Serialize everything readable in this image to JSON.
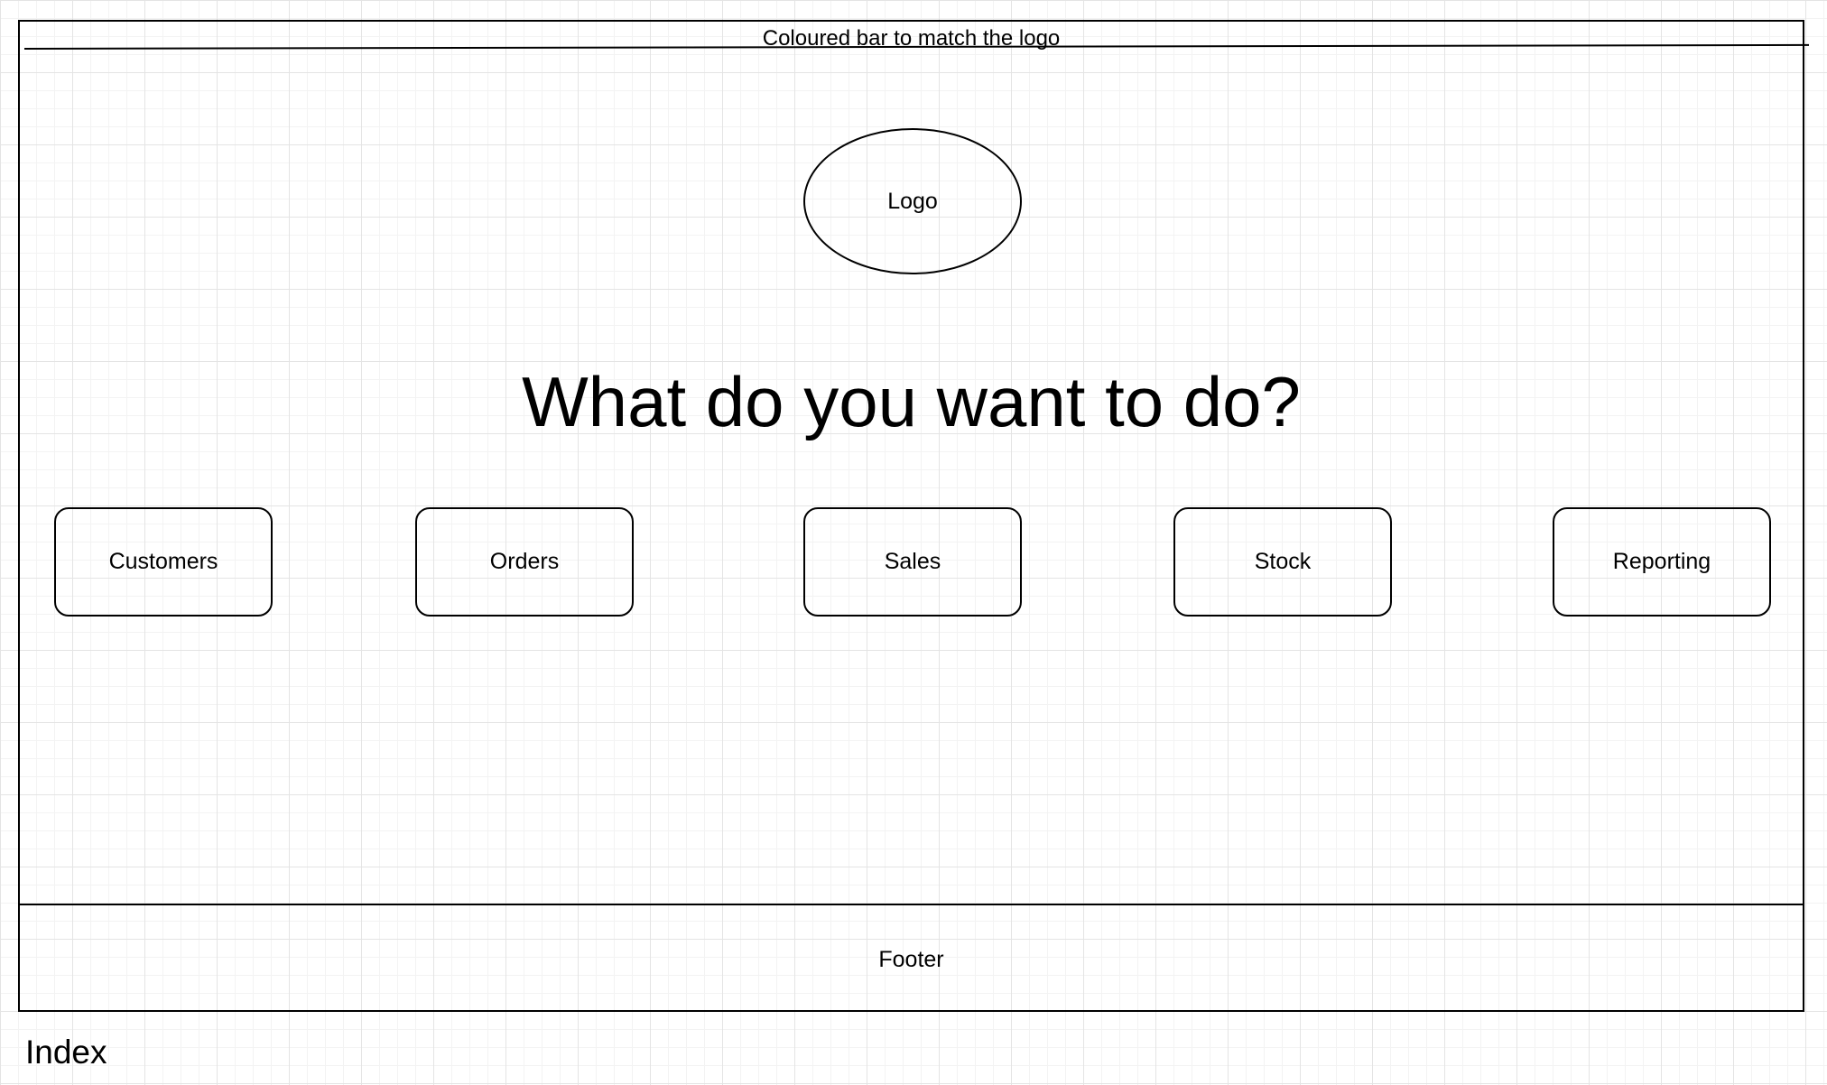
{
  "header": {
    "caption": "Coloured bar to match the logo"
  },
  "logo": {
    "label": "Logo"
  },
  "main": {
    "headline": "What do you want to do?",
    "actions": [
      {
        "label": "Customers"
      },
      {
        "label": "Orders"
      },
      {
        "label": "Sales"
      },
      {
        "label": "Stock"
      },
      {
        "label": "Reporting"
      }
    ]
  },
  "footer": {
    "label": "Footer"
  },
  "page": {
    "name": "Index"
  }
}
